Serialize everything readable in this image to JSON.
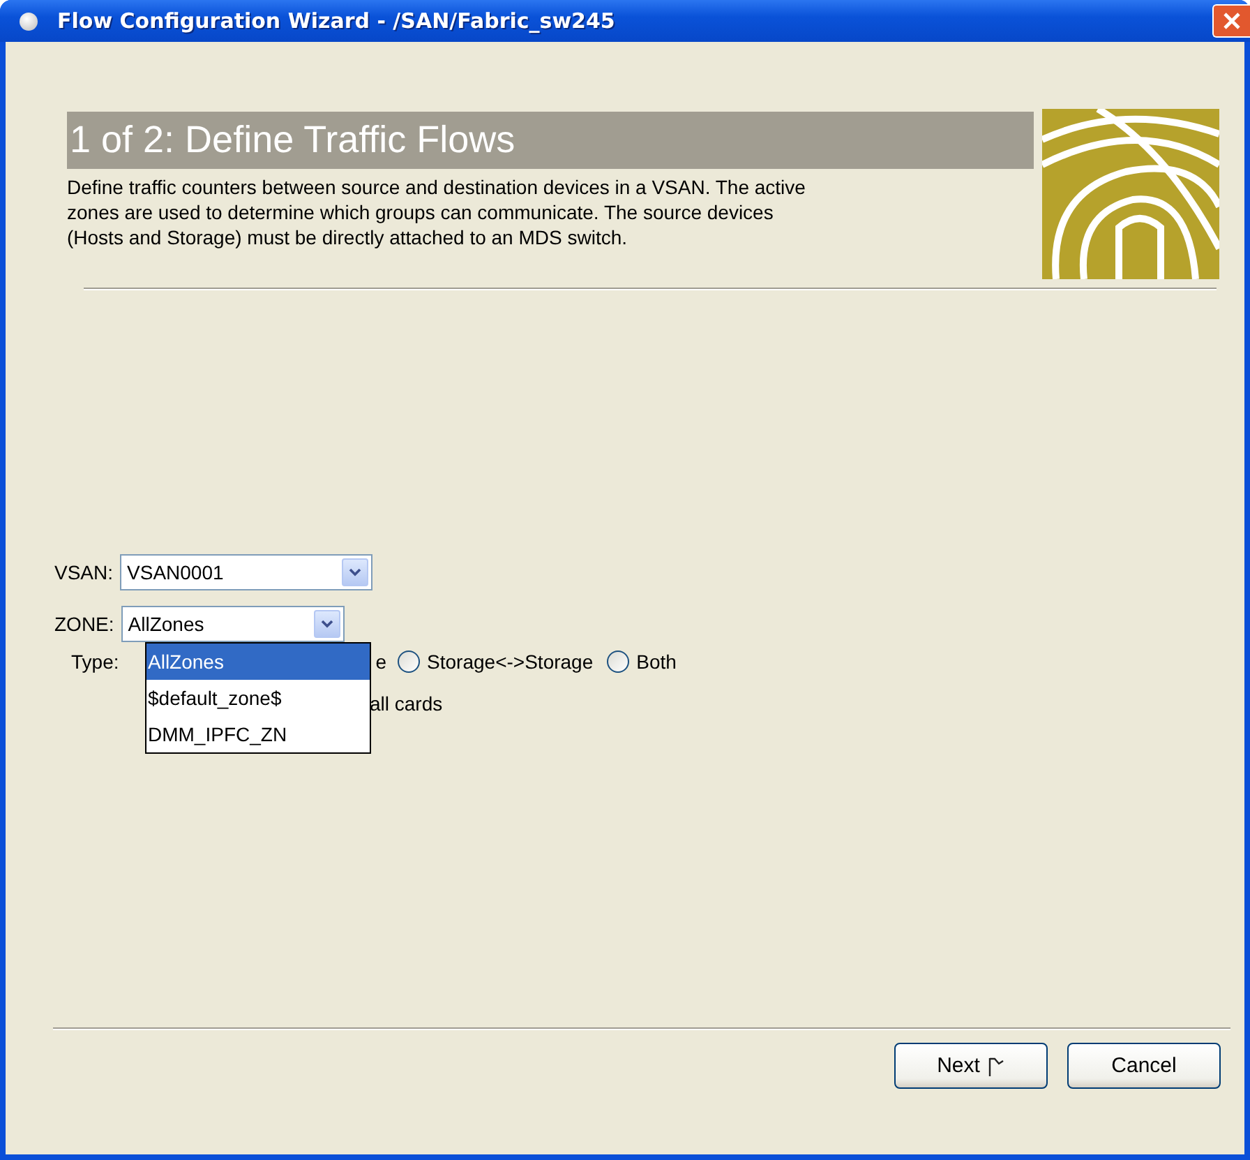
{
  "window": {
    "title": "Flow Configuration Wizard - /SAN/Fabric_sw245"
  },
  "header": {
    "step_title": "1 of 2: Define Traffic Flows",
    "description": "Define traffic counters between source and destination devices in a VSAN. The active zones are used to determine which groups can communicate. The source devices (Hosts and Storage) must be directly attached to an MDS switch."
  },
  "form": {
    "vsan": {
      "label": "VSAN:",
      "value": "VSAN0001"
    },
    "zone": {
      "label": "ZONE:",
      "value": "AllZones",
      "expanded": true,
      "options": [
        {
          "label": "AllZones",
          "selected": true
        },
        {
          "label": "$default_zone$",
          "selected": false
        },
        {
          "label": "DMM_IPFC_ZN",
          "selected": false
        }
      ]
    },
    "type": {
      "label": "Type:",
      "covered_text": "e",
      "options": [
        {
          "label": "Storage<->Storage",
          "selected": false
        },
        {
          "label": "Both",
          "selected": false
        }
      ]
    },
    "covered_row_text": "all cards"
  },
  "buttons": [
    {
      "label": "Next",
      "kind": "next"
    },
    {
      "label": "Cancel",
      "kind": "plain"
    }
  ]
}
